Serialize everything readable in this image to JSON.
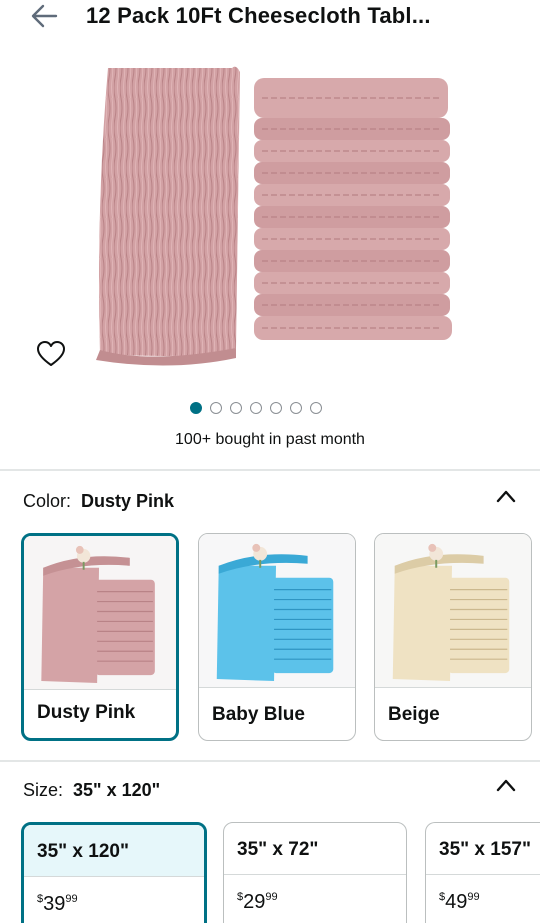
{
  "header": {
    "title": "12 Pack 10Ft Cheesecloth Tabl...",
    "back_icon": "arrow-left-icon"
  },
  "gallery": {
    "image_description_icon": "product-image",
    "page_count": 7,
    "active_index": 0,
    "bought_text": "100+ bought in past month"
  },
  "color": {
    "label": "Color:",
    "value": "Dusty Pink",
    "options": [
      {
        "name": "Dusty Pink",
        "fabric": "#d4a3a6",
        "fabric_dark": "#bf8a8e",
        "selected": true
      },
      {
        "name": "Baby Blue",
        "fabric": "#5cc2ea",
        "fabric_dark": "#3aa9d6",
        "selected": false
      },
      {
        "name": "Beige",
        "fabric": "#efe2c3",
        "fabric_dark": "#dccca6",
        "selected": false
      }
    ]
  },
  "size": {
    "label": "Size:",
    "value": "35\" x 120\"",
    "options": [
      {
        "size": "35\" x 120\"",
        "price_symbol": "$",
        "price_whole": "39",
        "price_fraction": "99",
        "selected": true
      },
      {
        "size": "35\" x 72\"",
        "price_symbol": "$",
        "price_whole": "29",
        "price_fraction": "99",
        "selected": false
      },
      {
        "size": "35\" x 157\"",
        "price_symbol": "$",
        "price_whole": "49",
        "price_fraction": "99",
        "selected": false
      }
    ]
  },
  "colors": {
    "accent": "#007185",
    "selected_bg": "#e6f7fa",
    "border": "#bbbfbf",
    "product_pink": "#d4a3a6",
    "product_pink_dark": "#bf8a8e"
  }
}
